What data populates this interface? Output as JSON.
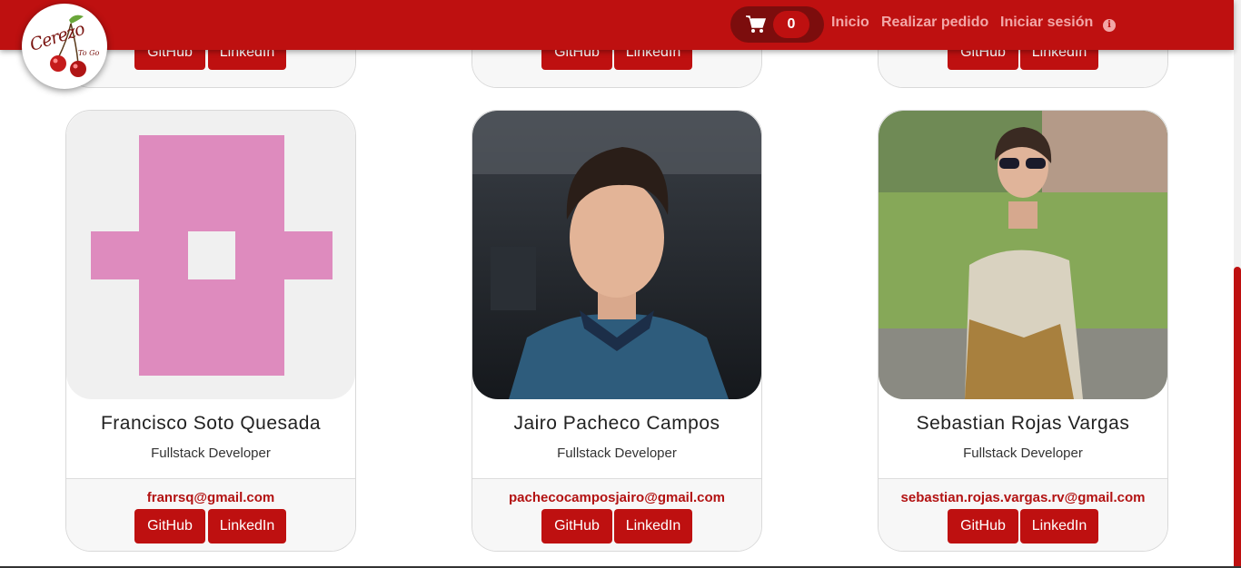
{
  "nav": {
    "cart_count": "0",
    "links": [
      "Inicio",
      "Realizar pedido",
      "Iniciar sesión"
    ],
    "logo_text": "Cerezo",
    "logo_subtext": "To Go"
  },
  "buttons": {
    "github": "GitHub",
    "linkedin": "LinkedIn"
  },
  "team": [
    {
      "name": "Francisco Soto Quesada",
      "role": "Fullstack Developer",
      "email": "franrsq@gmail.com",
      "avatar": "identicon"
    },
    {
      "name": "Jairo Pacheco Campos",
      "role": "Fullstack Developer",
      "email": "pachecocamposjairo@gmail.com",
      "avatar": "photo"
    },
    {
      "name": "Sebastian Rojas Vargas",
      "role": "Fullstack Developer",
      "email": "sebastian.rojas.vargas.rv@gmail.com",
      "avatar": "photo"
    }
  ],
  "colors": {
    "brand": "#be1010",
    "cart_bg": "#7c0d0d",
    "nav_link": "#f2a7a7",
    "identicon": "#de8bbe"
  },
  "icons": {
    "cart": "cart-icon",
    "info": "info-icon"
  }
}
